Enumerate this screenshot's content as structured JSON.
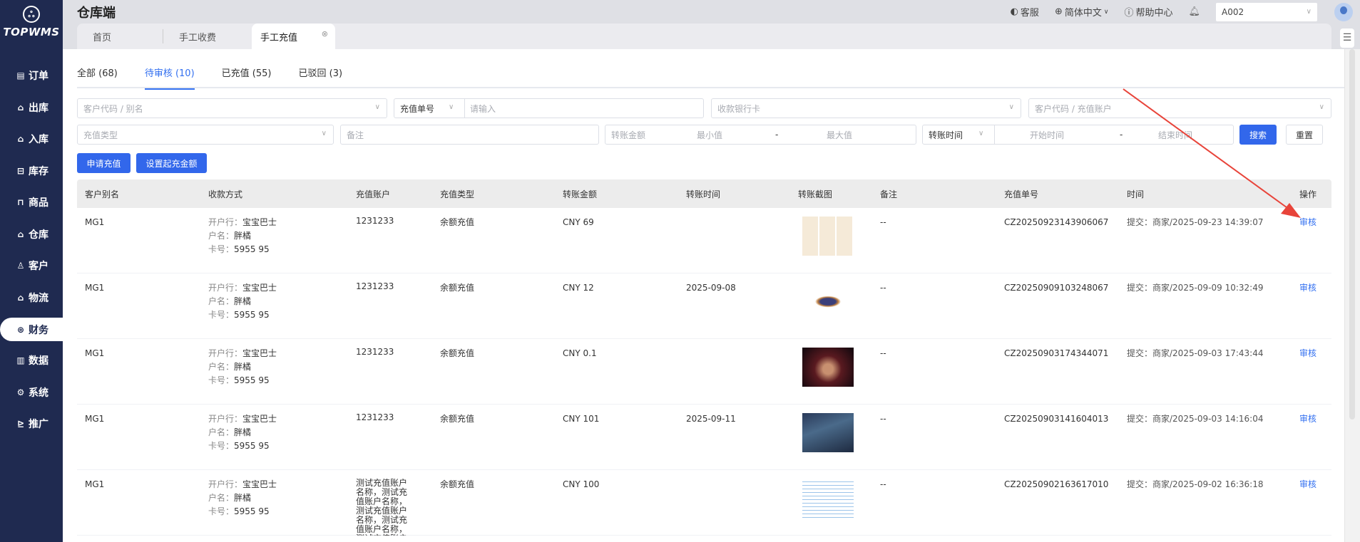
{
  "brand": {
    "logo_text": "TOPWMS"
  },
  "sidebar": {
    "items": [
      {
        "label": "订单",
        "icon": "order-icon"
      },
      {
        "label": "出库",
        "icon": "outbound-icon"
      },
      {
        "label": "入库",
        "icon": "inbound-icon"
      },
      {
        "label": "库存",
        "icon": "inventory-icon"
      },
      {
        "label": "商品",
        "icon": "product-icon"
      },
      {
        "label": "仓库",
        "icon": "warehouse-icon"
      },
      {
        "label": "客户",
        "icon": "customer-icon"
      },
      {
        "label": "物流",
        "icon": "logistics-icon"
      },
      {
        "label": "财务",
        "icon": "finance-icon",
        "active": true
      },
      {
        "label": "数据",
        "icon": "data-icon"
      },
      {
        "label": "系统",
        "icon": "system-icon"
      },
      {
        "label": "推广",
        "icon": "promotion-icon"
      }
    ]
  },
  "header": {
    "title": "仓库端",
    "service": "客服",
    "language": "简体中文",
    "help": "帮助中心",
    "account": "A002"
  },
  "page_tabs": [
    {
      "label": "首页"
    },
    {
      "label": "手工收费"
    },
    {
      "label": "手工充值",
      "active": true
    }
  ],
  "status_tabs": [
    {
      "label": "全部 (68)"
    },
    {
      "label": "待审核 (10)",
      "active": true
    },
    {
      "label": "已充值 (55)"
    },
    {
      "label": "已驳回 (3)"
    }
  ],
  "filters": {
    "customer_placeholder": "客户代码 / 别名",
    "order_no_type": "充值单号",
    "order_no_placeholder": "请输入",
    "bank_card_placeholder": "收款银行卡",
    "customer_account_placeholder": "客户代码 / 充值账户",
    "type_placeholder": "充值类型",
    "remark_placeholder": "备注",
    "amount_label": "转账金额",
    "min_placeholder": "最小值",
    "max_placeholder": "最大值",
    "range_sep": "-",
    "time_type": "转账时间",
    "start_placeholder": "开始时间",
    "end_placeholder": "结束时间",
    "search": "搜索",
    "reset": "重置"
  },
  "actions": {
    "apply": "申请充值",
    "set_min": "设置起充金额"
  },
  "table": {
    "columns": [
      "客户别名",
      "收款方式",
      "充值账户",
      "充值类型",
      "转账金额",
      "转账时间",
      "转账截图",
      "备注",
      "充值单号",
      "时间",
      "操作"
    ],
    "pay_labels": {
      "bank": "开户行：",
      "name": "户名：",
      "card": "卡号："
    },
    "rows": [
      {
        "alias": "MG1",
        "bank": "宝宝巴士",
        "name": "胖橘",
        "card": "5955 95",
        "account": "1231233",
        "type": "余额充值",
        "amount": "CNY 69",
        "transfer_time": "",
        "remark": "--",
        "order_no": "CZ20250923143906067",
        "time": "提交：商家/2025-09-23 14:39:07",
        "action": "审核"
      },
      {
        "alias": "MG1",
        "bank": "宝宝巴士",
        "name": "胖橘",
        "card": "5955 95",
        "account": "1231233",
        "type": "余额充值",
        "amount": "CNY 12",
        "transfer_time": "2025-09-08",
        "remark": "--",
        "order_no": "CZ20250909103248067",
        "time": "提交：商家/2025-09-09 10:32:49",
        "action": "审核"
      },
      {
        "alias": "MG1",
        "bank": "宝宝巴士",
        "name": "胖橘",
        "card": "5955 95",
        "account": "1231233",
        "type": "余额充值",
        "amount": "CNY 0.1",
        "transfer_time": "",
        "remark": "--",
        "order_no": "CZ20250903174344071",
        "time": "提交：商家/2025-09-03 17:43:44",
        "action": "审核"
      },
      {
        "alias": "MG1",
        "bank": "宝宝巴士",
        "name": "胖橘",
        "card": "5955 95",
        "account": "1231233",
        "type": "余额充值",
        "amount": "CNY 101",
        "transfer_time": "2025-09-11",
        "remark": "--",
        "order_no": "CZ20250903141604013",
        "time": "提交：商家/2025-09-03 14:16:04",
        "action": "审核"
      },
      {
        "alias": "MG1",
        "bank": "宝宝巴士",
        "name": "胖橘",
        "card": "5955 95",
        "account": "测试充值账户名称，测试充值账户名称，测试充值账户名称，测试充值账户名称，测试充值账户名称，测试充",
        "type": "余额充值",
        "amount": "CNY 100",
        "transfer_time": "",
        "remark": "--",
        "order_no": "CZ20250902163617010",
        "time": "提交：商家/2025-09-02 16:36:18",
        "action": "审核"
      }
    ]
  },
  "colors": {
    "sidebar": "#1f2a50",
    "primary": "#3267eb",
    "annotation_arrow": "#e8443a"
  }
}
